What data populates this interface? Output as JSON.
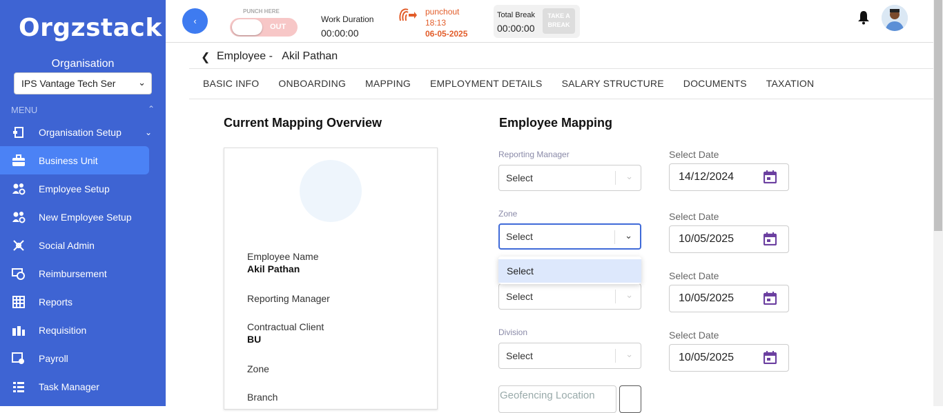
{
  "app": {
    "logo": "Orgzstack"
  },
  "sidebar": {
    "org_title": "Organisation",
    "org_selected": "IPS Vantage Tech Ser",
    "menu_label": "MENU",
    "items": [
      {
        "label": "Organisation Setup",
        "icon": "org-setup-icon"
      },
      {
        "label": "Business Unit",
        "icon": "briefcase-icon"
      },
      {
        "label": "Employee Setup",
        "icon": "users-gear-icon"
      },
      {
        "label": "New Employee Setup",
        "icon": "users-gear-icon"
      },
      {
        "label": "Social Admin",
        "icon": "social-icon"
      },
      {
        "label": "Reimbursement",
        "icon": "reimbursement-icon"
      },
      {
        "label": "Reports",
        "icon": "grid-icon"
      },
      {
        "label": "Requisition",
        "icon": "requisition-icon"
      },
      {
        "label": "Payroll",
        "icon": "payroll-icon"
      },
      {
        "label": "Task Manager",
        "icon": "list-icon"
      }
    ]
  },
  "topbar": {
    "punch_label": "PUNCH HERE",
    "punch_state": "OUT",
    "work_duration_label": "Work Duration",
    "work_duration_value": "00:00:00",
    "punchout_label": "punchout",
    "punchout_time": "18:13",
    "punchout_date": "06-05-2025",
    "total_break_label": "Total Break",
    "total_break_value": "00:00:00",
    "take_break_label": "TAKE A BREAK"
  },
  "header": {
    "title_prefix": "Employee -",
    "employee_name": "Akil Pathan"
  },
  "tabs": [
    "BASIC INFO",
    "ONBOARDING",
    "MAPPING",
    "EMPLOYMENT DETAILS",
    "SALARY STRUCTURE",
    "DOCUMENTS",
    "TAXATION"
  ],
  "overview": {
    "heading": "Current Mapping Overview",
    "employee_name_label": "Employee Name",
    "employee_name_value": "Akil Pathan",
    "reporting_manager_label": "Reporting Manager",
    "contractual_client_label": "Contractual Client",
    "contractual_client_value": "BU",
    "zone_label": "Zone",
    "branch_label": "Branch"
  },
  "mapping": {
    "heading": "Employee Mapping",
    "reporting_manager_label": "Reporting Manager",
    "reporting_manager_value": "Select",
    "zone_label": "Zone",
    "zone_value": "Select",
    "third_value": "Select",
    "division_label": "Division",
    "division_value": "Select",
    "dropdown_option": "Select",
    "date_label": "Select Date",
    "dates": [
      "14/12/2024",
      "10/05/2025",
      "10/05/2025",
      "10/05/2025"
    ],
    "geofencing_placeholder": "Geofencing Location"
  },
  "colors": {
    "sidebar": "#3e64d3",
    "active": "#4b82f5",
    "accent": "#3f6ad8",
    "punch": "#e25c29",
    "calendar": "#6b3fa0"
  }
}
